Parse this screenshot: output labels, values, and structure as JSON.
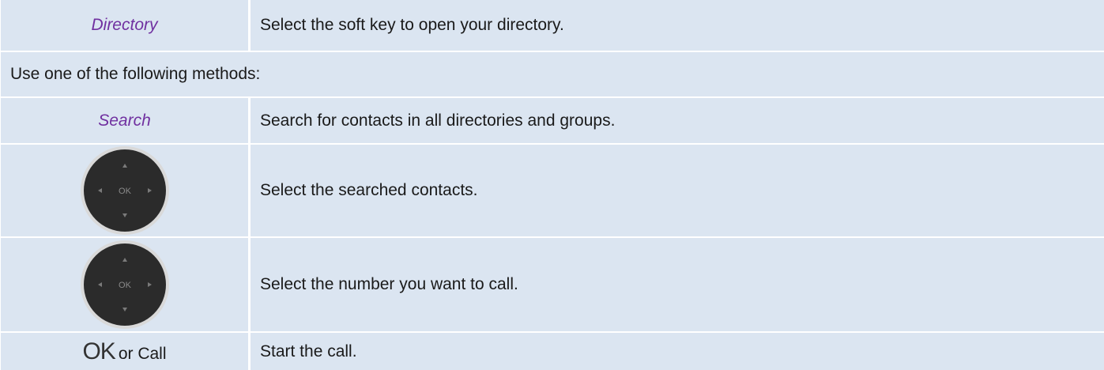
{
  "rows": [
    {
      "left": "Directory",
      "right": "Select the soft key to open your directory."
    },
    {
      "full": "Use one of the following methods:"
    },
    {
      "left": "Search",
      "right": "Search for contacts in all directories and groups."
    },
    {
      "left_icon": "navigation-ok-key-icon",
      "ok_label": "OK",
      "right": "Select the searched contacts."
    },
    {
      "left_icon": "navigation-ok-key-icon",
      "ok_label": "OK",
      "right": "Select the number you want to call."
    },
    {
      "left_ok": "OK",
      "left_or": "or Call",
      "right": "Start the call."
    }
  ],
  "colors": {
    "row_bg": "#dbe5f1",
    "softkey_text": "#7030a0",
    "key_body": "#2b2b2b",
    "key_ring": "#d9d9d9"
  }
}
